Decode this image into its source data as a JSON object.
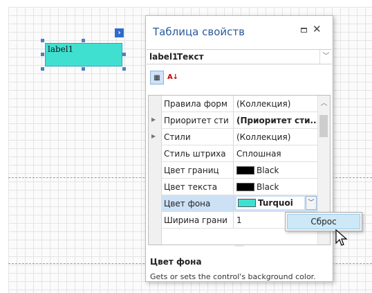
{
  "label_control": {
    "text": "label1"
  },
  "panel": {
    "title": "Таблица свойств",
    "selected_object": {
      "name": "label1",
      "type": "Текст"
    },
    "properties": [
      {
        "name": "Правила форм",
        "value": "(Коллекция)",
        "bold": false,
        "expander": false
      },
      {
        "name": "Приоритет сти",
        "value": "(Приоритет сти...",
        "bold": true,
        "expander": true
      },
      {
        "name": "Стили",
        "value": "(Коллекция)",
        "bold": false,
        "expander": true
      },
      {
        "name": "Стиль штриха",
        "value": "Сплошная",
        "bold": false,
        "expander": false
      },
      {
        "name": "Цвет границ",
        "value": "Black",
        "swatch": "#000000",
        "bold": false,
        "expander": false
      },
      {
        "name": "Цвет текста",
        "value": "Black",
        "swatch": "#000000",
        "bold": false,
        "expander": false
      },
      {
        "name": "Цвет фона",
        "value": "Turquoi",
        "swatch": "#40e0d0",
        "bold": true,
        "expander": false,
        "selected": true
      },
      {
        "name": "Ширина грани",
        "value": "1",
        "bold": false,
        "expander": false
      }
    ],
    "description": {
      "title": "Цвет фона",
      "text": "Gets or sets the control's background color."
    }
  },
  "popup": {
    "reset_label": "Сброс"
  },
  "colors": {
    "turquoise": "#40e0d0",
    "selection": "#cde1f5",
    "title_blue": "#2a5a9c"
  }
}
